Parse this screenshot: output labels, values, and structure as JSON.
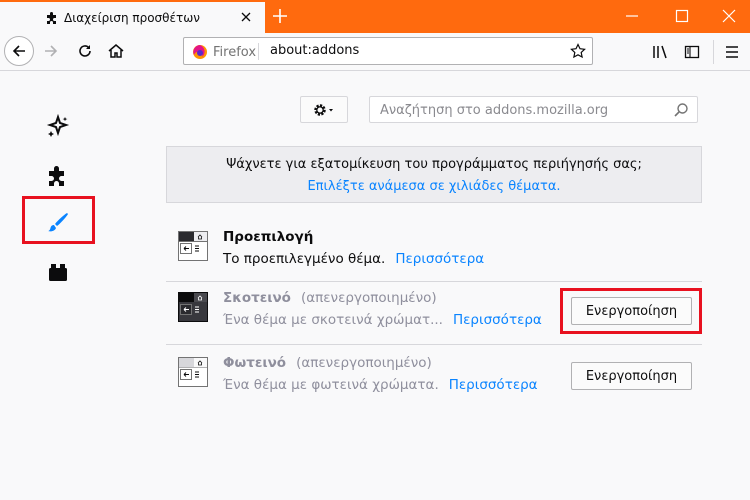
{
  "tab": {
    "title": "Διαχείριση προσθέτων",
    "icon": "puzzle-icon"
  },
  "urlbar": {
    "identity_label": "Firefox",
    "url": "about:addons"
  },
  "sidebar": {
    "items": [
      {
        "name": "recommendations",
        "icon": "sparkle-icon"
      },
      {
        "name": "extensions",
        "icon": "puzzle-icon"
      },
      {
        "name": "themes",
        "icon": "brush-icon",
        "selected": true
      },
      {
        "name": "plugins",
        "icon": "plugin-icon"
      }
    ]
  },
  "search": {
    "placeholder": "Αναζήτηση στο addons.mozilla.org"
  },
  "banner": {
    "text": "Ψάχνετε για εξατομίκευση του προγράμματος περιήγησής σας;",
    "link": "Επιλέξτε ανάμεσα σε χιλιάδες θέματα."
  },
  "themes": [
    {
      "name": "Προεπιλογή",
      "status": "",
      "description": "Το προεπιλεγμένο θέμα.",
      "more": "Περισσότερα",
      "button": ""
    },
    {
      "name": "Σκοτεινό",
      "status": "(απενεργοποιημένο)",
      "description": "Ένα θέμα με σκοτεινά χρώματ...",
      "more": "Περισσότερα",
      "button": "Ενεργοποίηση"
    },
    {
      "name": "Φωτεινό",
      "status": "(απενεργοποιημένο)",
      "description": "Ένα θέμα με φωτεινά χρώματα.",
      "more": "Περισσότερα",
      "button": "Ενεργοποίηση"
    }
  ],
  "colors": {
    "titlebar": "#ff6a0e",
    "link": "#0a84ff",
    "highlight": "#e8111f",
    "brush": "#0a84ff"
  }
}
